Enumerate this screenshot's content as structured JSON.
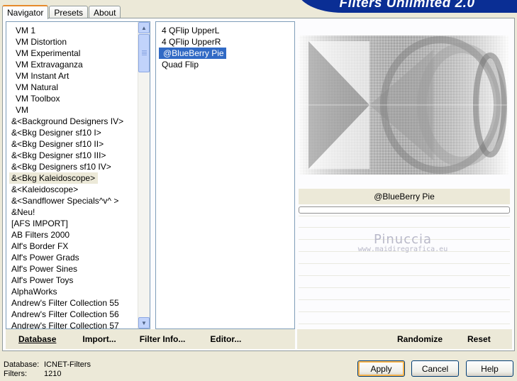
{
  "banner": {
    "title": "Filters Unlimited 2.0"
  },
  "tabs": [
    {
      "label": "Navigator",
      "active": true
    },
    {
      "label": "Presets",
      "active": false
    },
    {
      "label": "About",
      "active": false
    }
  ],
  "categories": {
    "items": [
      "VM 1",
      "VM Distortion",
      "VM Experimental",
      "VM Extravaganza",
      "VM Instant Art",
      "VM Natural",
      "VM Toolbox",
      "VM",
      "&<Background Designers IV>",
      "&<Bkg Designer sf10 I>",
      "&<Bkg Designer sf10 II>",
      "&<Bkg Designer sf10 III>",
      "&<Bkg Designers sf10 IV>",
      "&<Bkg Kaleidoscope>",
      "&<Kaleidoscope>",
      "&<Sandflower Specials^v^ >",
      "&Neu!",
      "[AFS IMPORT]",
      "AB Filters 2000",
      "Alf's Border FX",
      "Alf's Power Grads",
      "Alf's Power Sines",
      "Alf's Power Toys",
      "AlphaWorks",
      "Andrew's Filter Collection 55",
      "Andrew's Filter Collection 56",
      "Andrew's Filter Collection 57"
    ],
    "selected": "&<Bkg Kaleidoscope>"
  },
  "filters": {
    "items": [
      "4 QFlip UpperL",
      "4 QFlip UpperR",
      "@BlueBerry Pie",
      "Quad Flip"
    ],
    "selected": "@BlueBerry Pie"
  },
  "preview": {
    "filter_name": "@BlueBerry Pie",
    "watermark_title": "Pinuccia",
    "watermark_url": "www.maidiregrafica.eu"
  },
  "left_buttons": {
    "database": "Database",
    "import": "Import...",
    "filter_info": "Filter Info...",
    "editor": "Editor..."
  },
  "right_buttons": {
    "randomize": "Randomize",
    "reset": "Reset"
  },
  "footer": {
    "database_label": "Database:",
    "database_value": "ICNET-Filters",
    "filters_label": "Filters:",
    "filters_value": "1210"
  },
  "dialog_buttons": {
    "apply": "Apply",
    "cancel": "Cancel",
    "help": "Help"
  },
  "colors": {
    "selection": "#316ac5",
    "banner": "#0a2e94",
    "window": "#ece9d8"
  }
}
